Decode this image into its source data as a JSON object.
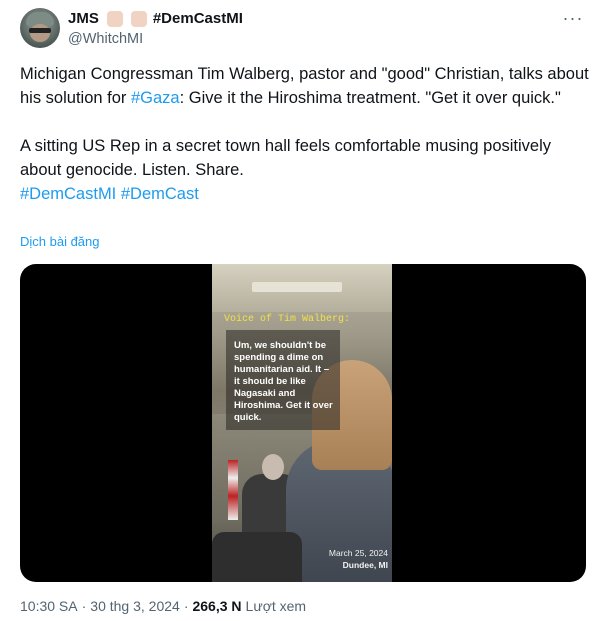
{
  "author": {
    "name": "JMS",
    "hashtag": "#DemCastMI",
    "handle": "@WhitchMI"
  },
  "tweet": {
    "line1_pre": "Michigan Congressman Tim Walberg, pastor and \"good\" Christian, talks about his solution for ",
    "line1_link": "#Gaza",
    "line1_post": ": Give it the Hiroshima treatment. \"Get it over quick.\"",
    "line2": "A sitting US Rep in a secret town hall feels comfortable musing positively about genocide. Listen. Share.",
    "hashtag1": "#DemCastMI",
    "hashtag2": "#DemCast",
    "translate": "Dịch bài đăng"
  },
  "video": {
    "caption_title": "Voice of Tim Walberg:",
    "caption_text": "Um, we shouldn't be spending a dime on humanitarian aid. It – it should be like Nagasaki and Hiroshima. Get it over quick.",
    "date": "March 25, 2024",
    "place": "Dundee, MI"
  },
  "meta": {
    "time": "10:30 SA",
    "sep1": "·",
    "date": "30 thg 3, 2024",
    "sep2": "·",
    "views": "266,3 N",
    "views_label": "Lượt xem"
  },
  "colors": {
    "link": "#1d9bf0",
    "secondary": "#536471",
    "caption_title": "#f0e14a"
  }
}
